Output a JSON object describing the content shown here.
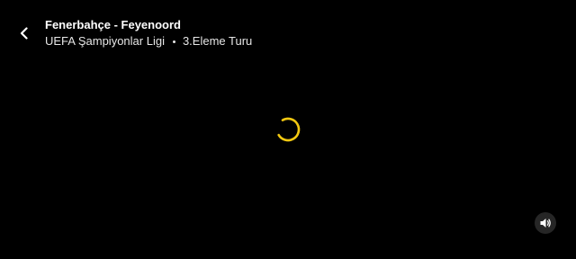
{
  "header": {
    "title": "Fenerbahçe - Feyenoord",
    "competition": "UEFA Şampiyonlar Ligi",
    "stage": "3.Eleme Turu",
    "back_icon": "chevron-left-icon"
  },
  "player": {
    "state_icon": "loading-spinner-icon",
    "spinner_color": "#f2c811",
    "background": "#000000",
    "volume_icon": "speaker-icon"
  }
}
